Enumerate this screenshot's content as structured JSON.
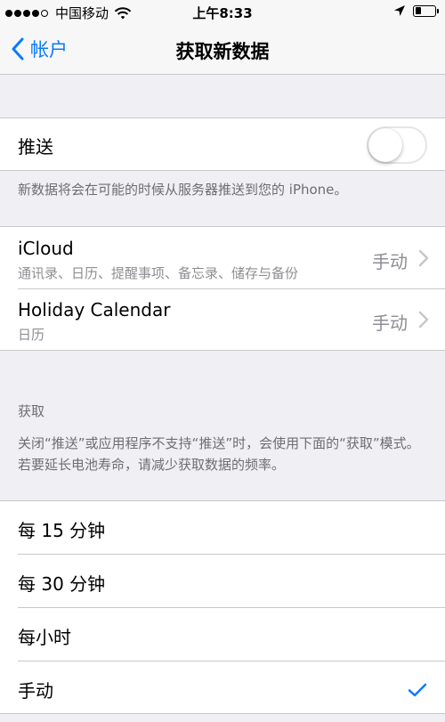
{
  "status_bar": {
    "carrier": "中国移动",
    "time": "上午8:33"
  },
  "nav": {
    "back_label": "帐户",
    "title": "获取新数据"
  },
  "push": {
    "label": "推送",
    "enabled": false,
    "footer": "新数据将会在可能的时候从服务器推送到您的 iPhone。"
  },
  "accounts": [
    {
      "name": "iCloud",
      "detail": "通讯录、日历、提醒事项、备忘录、储存与备份",
      "value": "手动"
    },
    {
      "name": "Holiday Calendar",
      "detail": "日历",
      "value": "手动"
    }
  ],
  "fetch": {
    "header": "获取",
    "footer": "关闭“推送”或应用程序不支持“推送”时，会使用下面的“获取”模式。若要延长电池寿命，请减少获取数据的频率。",
    "options": [
      {
        "label": "每 15 分钟",
        "selected": false
      },
      {
        "label": "每 30 分钟",
        "selected": false
      },
      {
        "label": "每小时",
        "selected": false
      },
      {
        "label": "手动",
        "selected": true
      }
    ]
  },
  "colors": {
    "accent": "#0a7aff",
    "secondary_text": "#8e8e93",
    "background": "#efeff4"
  }
}
